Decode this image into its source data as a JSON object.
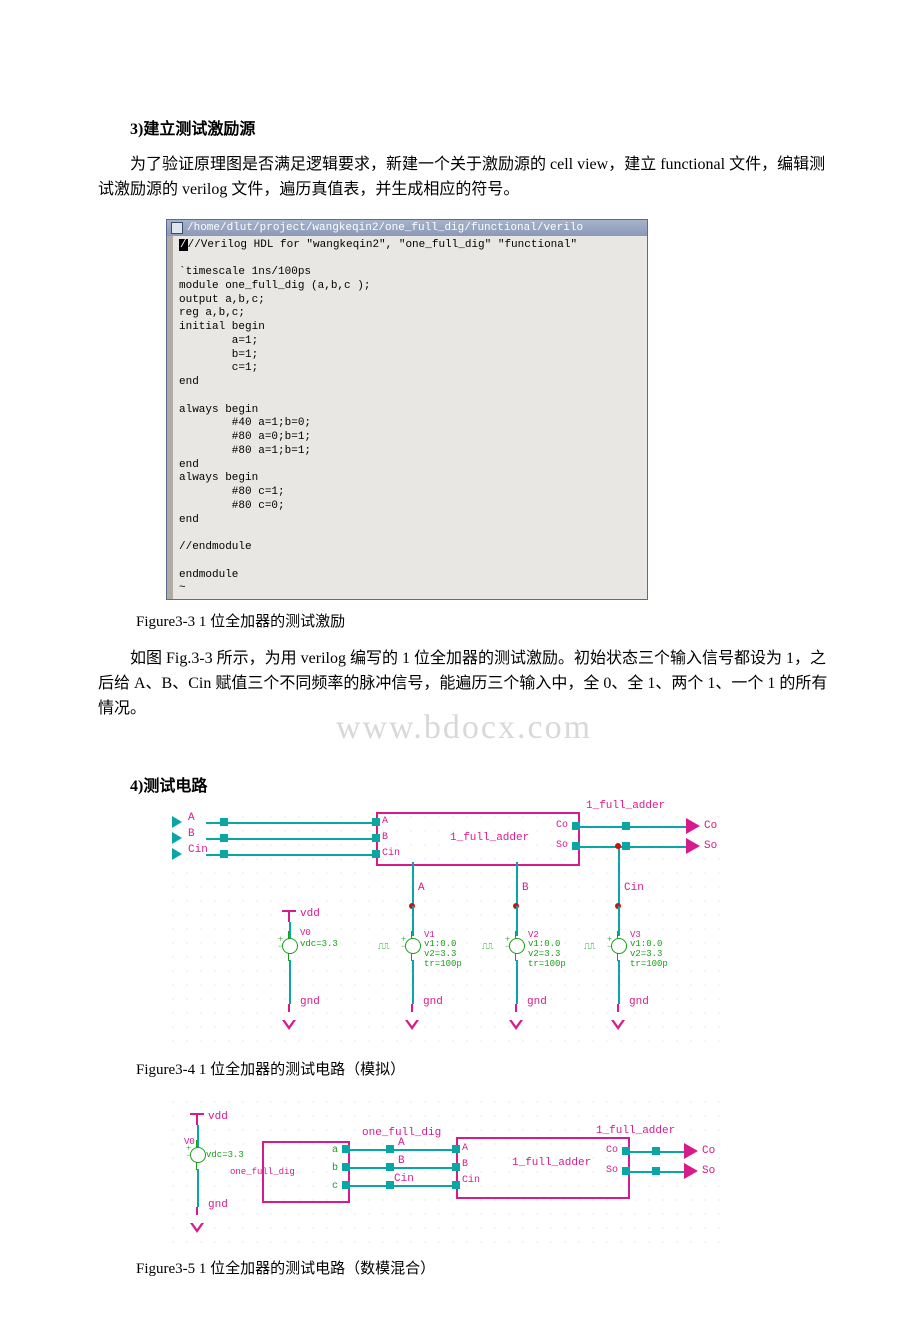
{
  "section3": {
    "heading": "3)建立测试激励源",
    "para": "为了验证原理图是否满足逻辑要求，新建一个关于激励源的 cell view，建立 functional 文件，编辑测试激励源的 verilog 文件，遍历真值表，并生成相应的符号。"
  },
  "codeWindow": {
    "titlePath": "/home/dlut/project/wangkeqin2/one_full_dig/functional/verilo",
    "firstLine": "//Verilog HDL for \"wangkeqin2\", \"one_full_dig\" \"functional\"",
    "body": "`timescale 1ns/100ps\nmodule one_full_dig (a,b,c );\noutput a,b,c;\nreg a,b,c;\ninitial begin\n        a=1;\n        b=1;\n        c=1;\nend\n\nalways begin\n        #40 a=1;b=0;\n        #80 a=0;b=1;\n        #80 a=1;b=1;\nend\nalways begin\n        #80 c=1;\n        #80 c=0;\nend\n\n//endmodule\n\nendmodule\n~"
  },
  "fig33_caption": "Figure3-3 1 位全加器的测试激励",
  "para2": "如图 Fig.3-3 所示，为用 verilog 编写的 1 位全加器的测试激励。初始状态三个输入信号都设为 1，之后给 A、B、Cin 赋值三个不同频率的脉冲信号，能遍历三个输入中，全 0、全 1、两个 1、一个 1 的所有情况。",
  "watermark": "www.bdocx.com",
  "section4": {
    "heading": "4)测试电路"
  },
  "sch1": {
    "inputs": [
      "A",
      "B",
      "Cin"
    ],
    "block": {
      "name": "1_full_adder",
      "instLabel": "1_full_adder",
      "portsIn": [
        "A",
        "B",
        "Cin"
      ],
      "portsOut": [
        "Co",
        "So"
      ]
    },
    "outputs": [
      "Co",
      "So"
    ],
    "vdd": "vdd",
    "gnd": "gnd",
    "v0": {
      "inst": "V0",
      "param": "vdc=3.3"
    },
    "pulseParams": {
      "v1": "v1:0.0",
      "v2": "v2=3.3",
      "tr": "tr=100p"
    },
    "pulseInsts": [
      "V1",
      "V2",
      "V3"
    ],
    "pulseNets": [
      "A",
      "B",
      "Cin"
    ]
  },
  "fig34_caption": "Figure3-4 1 位全加器的测试电路（模拟）",
  "sch2": {
    "vdd": "vdd",
    "gnd": "gnd",
    "v0": {
      "inst": "V0",
      "param": "vdc=3.3"
    },
    "digBlock": {
      "name": "one_full_dig",
      "instLabel": "one_full_dig",
      "ports": [
        "a",
        "b",
        "c"
      ],
      "nets": [
        "A",
        "B",
        "Cin"
      ]
    },
    "adderBlock": {
      "name": "1_full_adder",
      "instLabel": "1_full_adder",
      "portsIn": [
        "A",
        "B",
        "Cin"
      ],
      "portsOut": [
        "Co",
        "So"
      ]
    },
    "outputs": [
      "Co",
      "So"
    ]
  },
  "fig35_caption": "Figure3-5 1 位全加器的测试电路（数模混合）"
}
